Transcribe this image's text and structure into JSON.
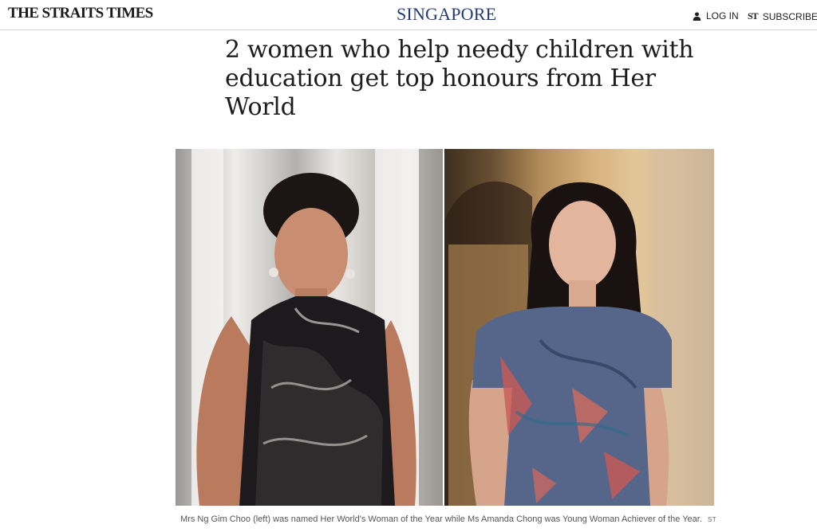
{
  "header": {
    "logo": "THE STRAITS TIMES",
    "section": "SINGAPORE",
    "login_label": "LOG IN",
    "subscribe_mark": "ST",
    "subscribe_label": "SUBSCRIBE",
    "login_icon": "user-icon"
  },
  "article": {
    "headline": "2 women who help needy children with education get top honours from Her World",
    "caption": "Mrs Ng Gim Choo (left) was named Her World's Woman of the Year while Ms Amanda Chong was Young Woman Achiever of the Year.",
    "caption_credit": "ST"
  },
  "colors": {
    "section_blue": "#233a75",
    "text_dark": "#1d1d1d"
  }
}
